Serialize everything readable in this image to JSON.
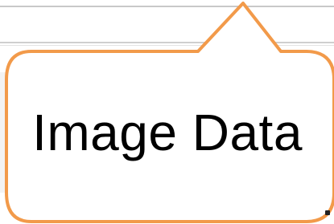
{
  "callout": {
    "text": "Image Data",
    "border_color": "#f29a4a",
    "fill_color": "#ffffff",
    "text_color": "#000000"
  },
  "background": {
    "line_color": "#c8c8c8"
  }
}
